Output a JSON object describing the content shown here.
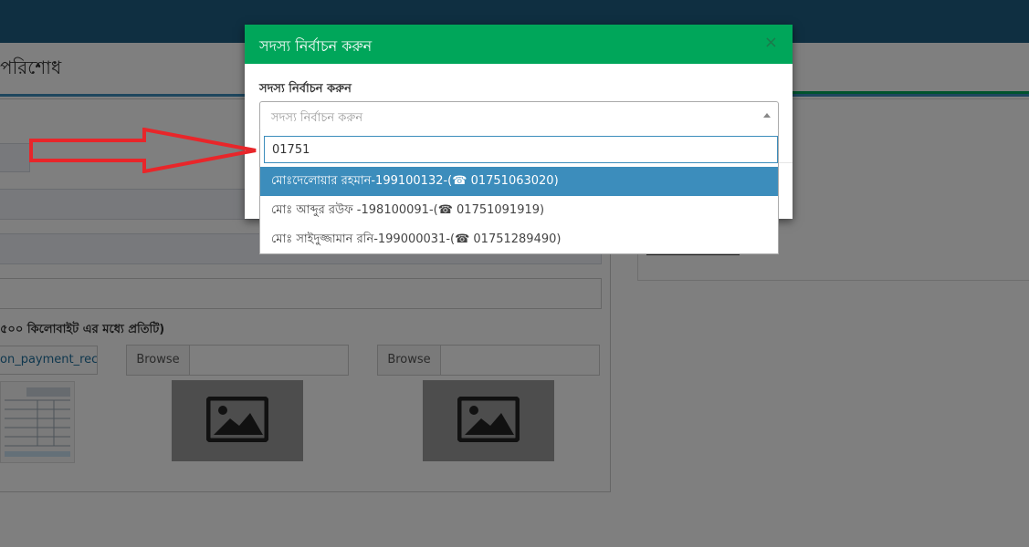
{
  "page": {
    "title": "পরিশোধ",
    "upload_hint": "৫০০ কিলোবাইট এর মধ্যে প্রতিটি)",
    "file_name": "on_payment_rec",
    "browse_label": "Browse"
  },
  "modal": {
    "title": "সদস্য নির্বাচন করুন",
    "close_glyph": "×",
    "field_label": "সদস্য নির্বাচন করুন",
    "select_placeholder": "সদস্য নির্বাচন করুন",
    "search_value": "01751",
    "options": [
      {
        "label": "মোঃদেলোয়ার রহমান-199100132-(☎ 01751063020)",
        "active": true
      },
      {
        "label": "মোঃ আব্দুর রউফ -198100091-(☎ 01751091919)",
        "active": false
      },
      {
        "label": "মোঃ সাইদুজ্জামান রনি-199000031-(☎ 01751289490)",
        "active": false
      }
    ]
  },
  "colors": {
    "topbar": "#1f5f82",
    "modal_header": "#00a65a",
    "highlight": "#3c8dbc",
    "annotation_arrow": "#e8262a"
  },
  "icons": [
    "image-placeholder-icon",
    "dropdown-arrow-icon",
    "close-icon",
    "phone-icon",
    "annotation-arrow-icon"
  ]
}
